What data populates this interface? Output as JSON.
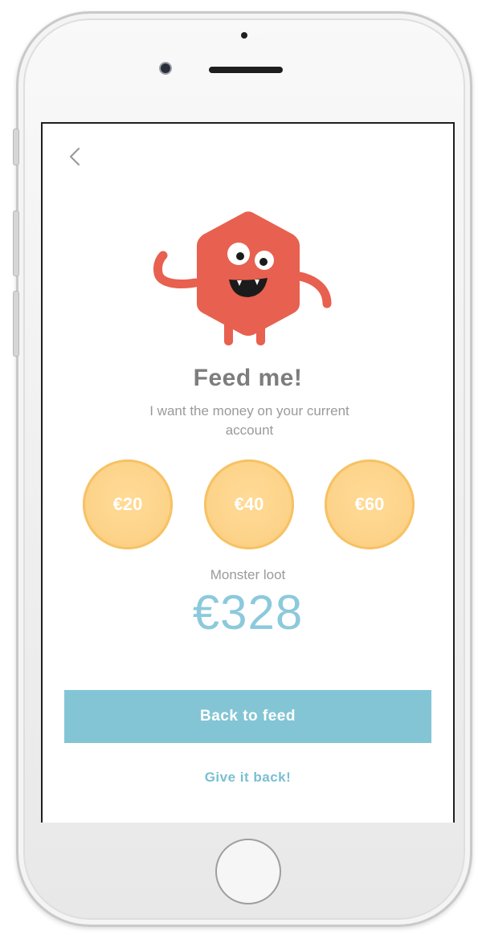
{
  "screen": {
    "title": "Feed me!",
    "subtitle": "I want the money on your current account",
    "amount_options": [
      "€20",
      "€40",
      "€60"
    ],
    "loot_label": "Monster loot",
    "loot_value": "€328",
    "primary_button_label": "Back to feed",
    "secondary_link_label": "Give it back!"
  },
  "icons": {
    "back": "chevron-left-icon",
    "mascot": "monster-mascot"
  },
  "colors": {
    "accent_blue": "#83c5d5",
    "loot_text": "#8cc9dc",
    "coin_fill": "#fdd38a",
    "monster_red": "#e8604f",
    "heading_gray": "#7d7d7d"
  }
}
